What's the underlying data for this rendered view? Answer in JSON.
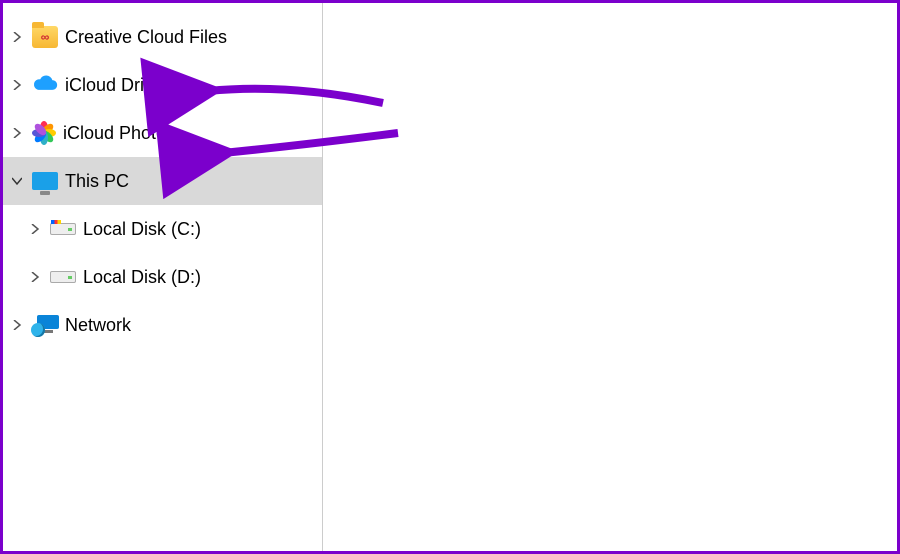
{
  "navigation": {
    "items": [
      {
        "label": "Creative Cloud Files",
        "expanded": false,
        "level": 0,
        "icon": "creative-cloud-folder"
      },
      {
        "label": "iCloud Drive",
        "expanded": false,
        "level": 0,
        "icon": "icloud-cloud",
        "highlighted": true
      },
      {
        "label": "iCloud Photos",
        "expanded": false,
        "level": 0,
        "icon": "icloud-photos",
        "highlighted": true
      },
      {
        "label": "This PC",
        "expanded": true,
        "level": 0,
        "icon": "this-pc-monitor",
        "selected": true
      },
      {
        "label": "Local Disk (C:)",
        "expanded": false,
        "level": 1,
        "icon": "local-disk-c"
      },
      {
        "label": "Local Disk (D:)",
        "expanded": false,
        "level": 1,
        "icon": "local-disk-d"
      },
      {
        "label": "Network",
        "expanded": false,
        "level": 0,
        "icon": "network"
      }
    ]
  },
  "annotation_color": "#7b00cc"
}
